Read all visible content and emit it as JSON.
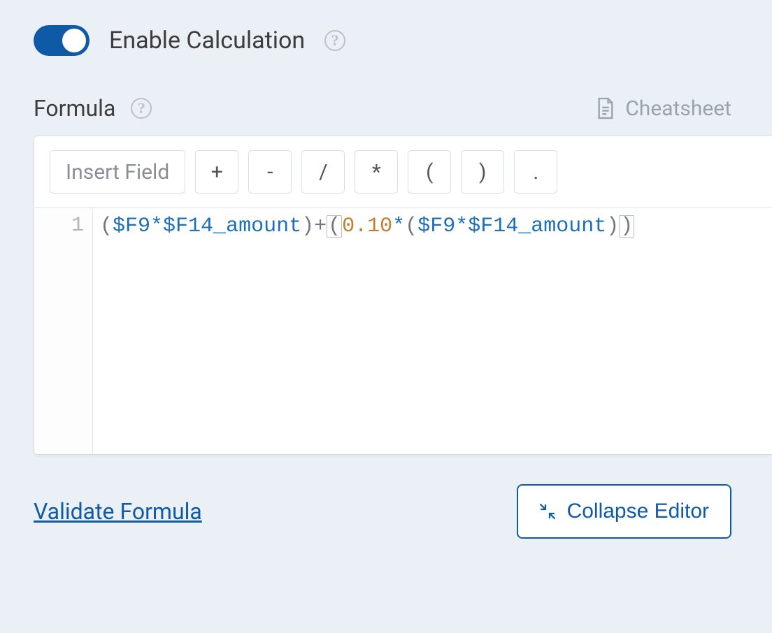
{
  "toggle": {
    "label": "Enable Calculation",
    "on": true
  },
  "formula": {
    "label": "Formula"
  },
  "cheatsheet": {
    "label": "Cheatsheet"
  },
  "toolbar": {
    "insert": "Insert Field",
    "plus": "+",
    "minus": "-",
    "divide": "/",
    "multiply": "*",
    "lparen": "(",
    "rparen": ")",
    "dot": "."
  },
  "editor": {
    "line_number": "1",
    "tokens": {
      "p1": "(",
      "v1": "$F9",
      "op1": "*",
      "v2": "$F14_amount",
      "p2": ")",
      "plus": "+",
      "p3": "(",
      "num": "0.10",
      "op2": "*",
      "p4": "(",
      "v3": "$F9",
      "op3": "*",
      "v4": "$F14_amount",
      "p5": ")",
      "p6": ")"
    }
  },
  "actions": {
    "validate": "Validate Formula",
    "collapse": "Collapse Editor"
  }
}
